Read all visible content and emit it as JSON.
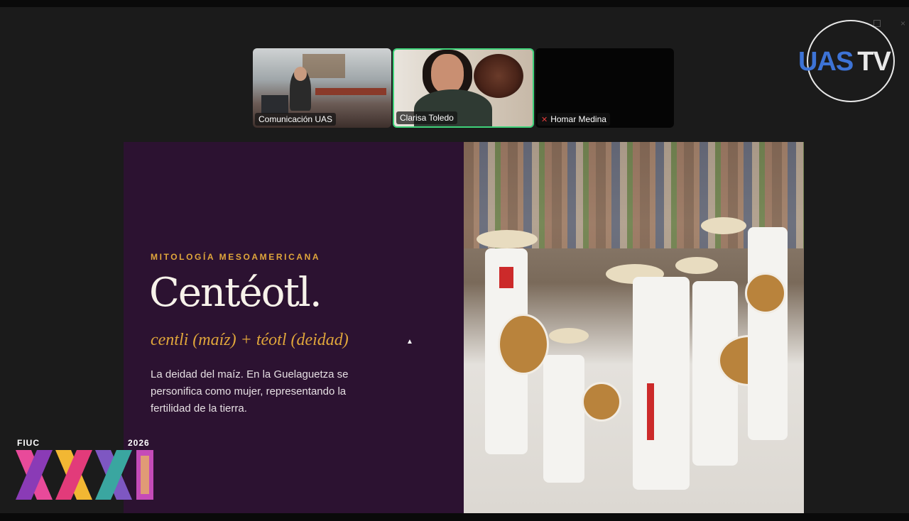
{
  "meeting": {
    "participants": [
      {
        "name": "Comunicación UAS",
        "active": false,
        "muted": false
      },
      {
        "name": "Clarisa Toledo",
        "active": true,
        "muted": false
      },
      {
        "name": "Homar Medina",
        "active": false,
        "muted": true
      }
    ],
    "active_speaker_color": "#3fd27a"
  },
  "broadcast": {
    "logo_part1": "UAS",
    "logo_part2": "TV",
    "brand_color": "#3d73d6"
  },
  "slide": {
    "eyebrow": "MITOLOGÍA MESOAMERICANA",
    "title": "Centéotl.",
    "subtitle": "centli (maíz) + téotl (deidad)",
    "body": "La deidad del maíz. En la Guelaguetza se personifica como mujer, representando la fertilidad de la tierra.",
    "background_color": "#2c1231",
    "accent_color": "#e0a63b"
  },
  "event_logo": {
    "label": "FIUC",
    "year": "2026"
  }
}
